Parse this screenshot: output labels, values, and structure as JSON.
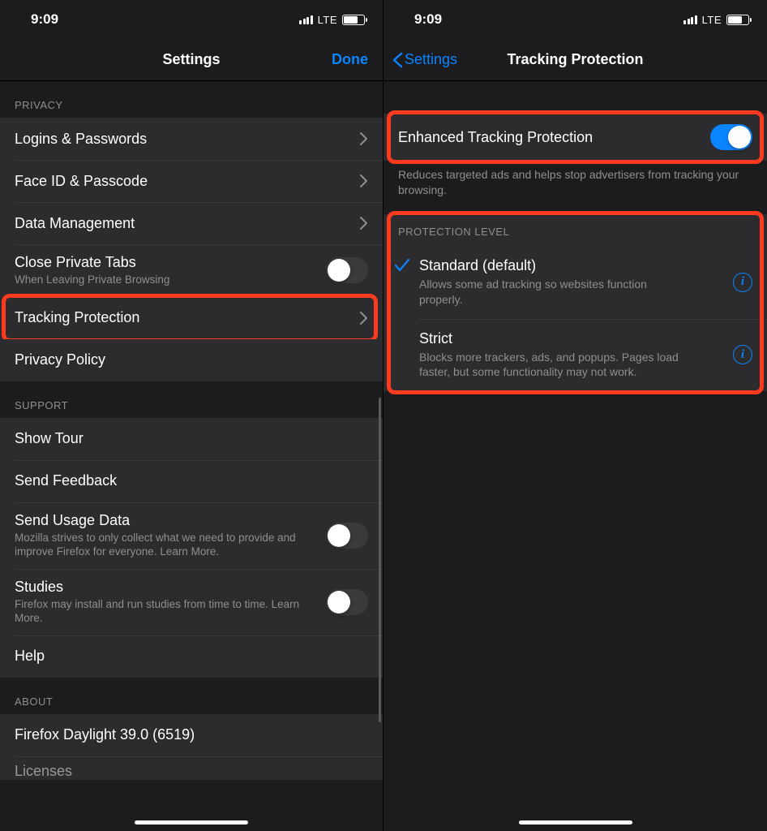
{
  "statusBar": {
    "time": "9:09",
    "network": "LTE"
  },
  "left": {
    "nav": {
      "title": "Settings",
      "done": "Done"
    },
    "privacy": {
      "header": "PRIVACY",
      "items": [
        {
          "title": "Logins & Passwords"
        },
        {
          "title": "Face ID & Passcode"
        },
        {
          "title": "Data Management"
        },
        {
          "title": "Close Private Tabs",
          "sub": "When Leaving Private Browsing"
        },
        {
          "title": "Tracking Protection"
        },
        {
          "title": "Privacy Policy"
        }
      ]
    },
    "support": {
      "header": "SUPPORT",
      "items": [
        {
          "title": "Show Tour"
        },
        {
          "title": "Send Feedback"
        },
        {
          "title": "Send Usage Data",
          "sub": "Mozilla strives to only collect what we need to provide and improve Firefox for everyone. Learn More."
        },
        {
          "title": "Studies",
          "sub": "Firefox may install and run studies from time to time. Learn More."
        },
        {
          "title": "Help"
        }
      ]
    },
    "about": {
      "header": "ABOUT",
      "items": [
        {
          "title": "Firefox Daylight 39.0 (6519)"
        },
        {
          "title": "Licenses"
        }
      ]
    }
  },
  "right": {
    "nav": {
      "back": "Settings",
      "title": "Tracking Protection"
    },
    "etp": {
      "title": "Enhanced Tracking Protection",
      "footer": "Reduces targeted ads and helps stop advertisers from tracking your browsing."
    },
    "level": {
      "header": "PROTECTION LEVEL",
      "options": [
        {
          "title": "Standard (default)",
          "sub": "Allows some ad tracking so websites function properly."
        },
        {
          "title": "Strict",
          "sub": "Blocks more trackers, ads, and popups. Pages load faster, but some functionality may not work."
        }
      ]
    }
  }
}
